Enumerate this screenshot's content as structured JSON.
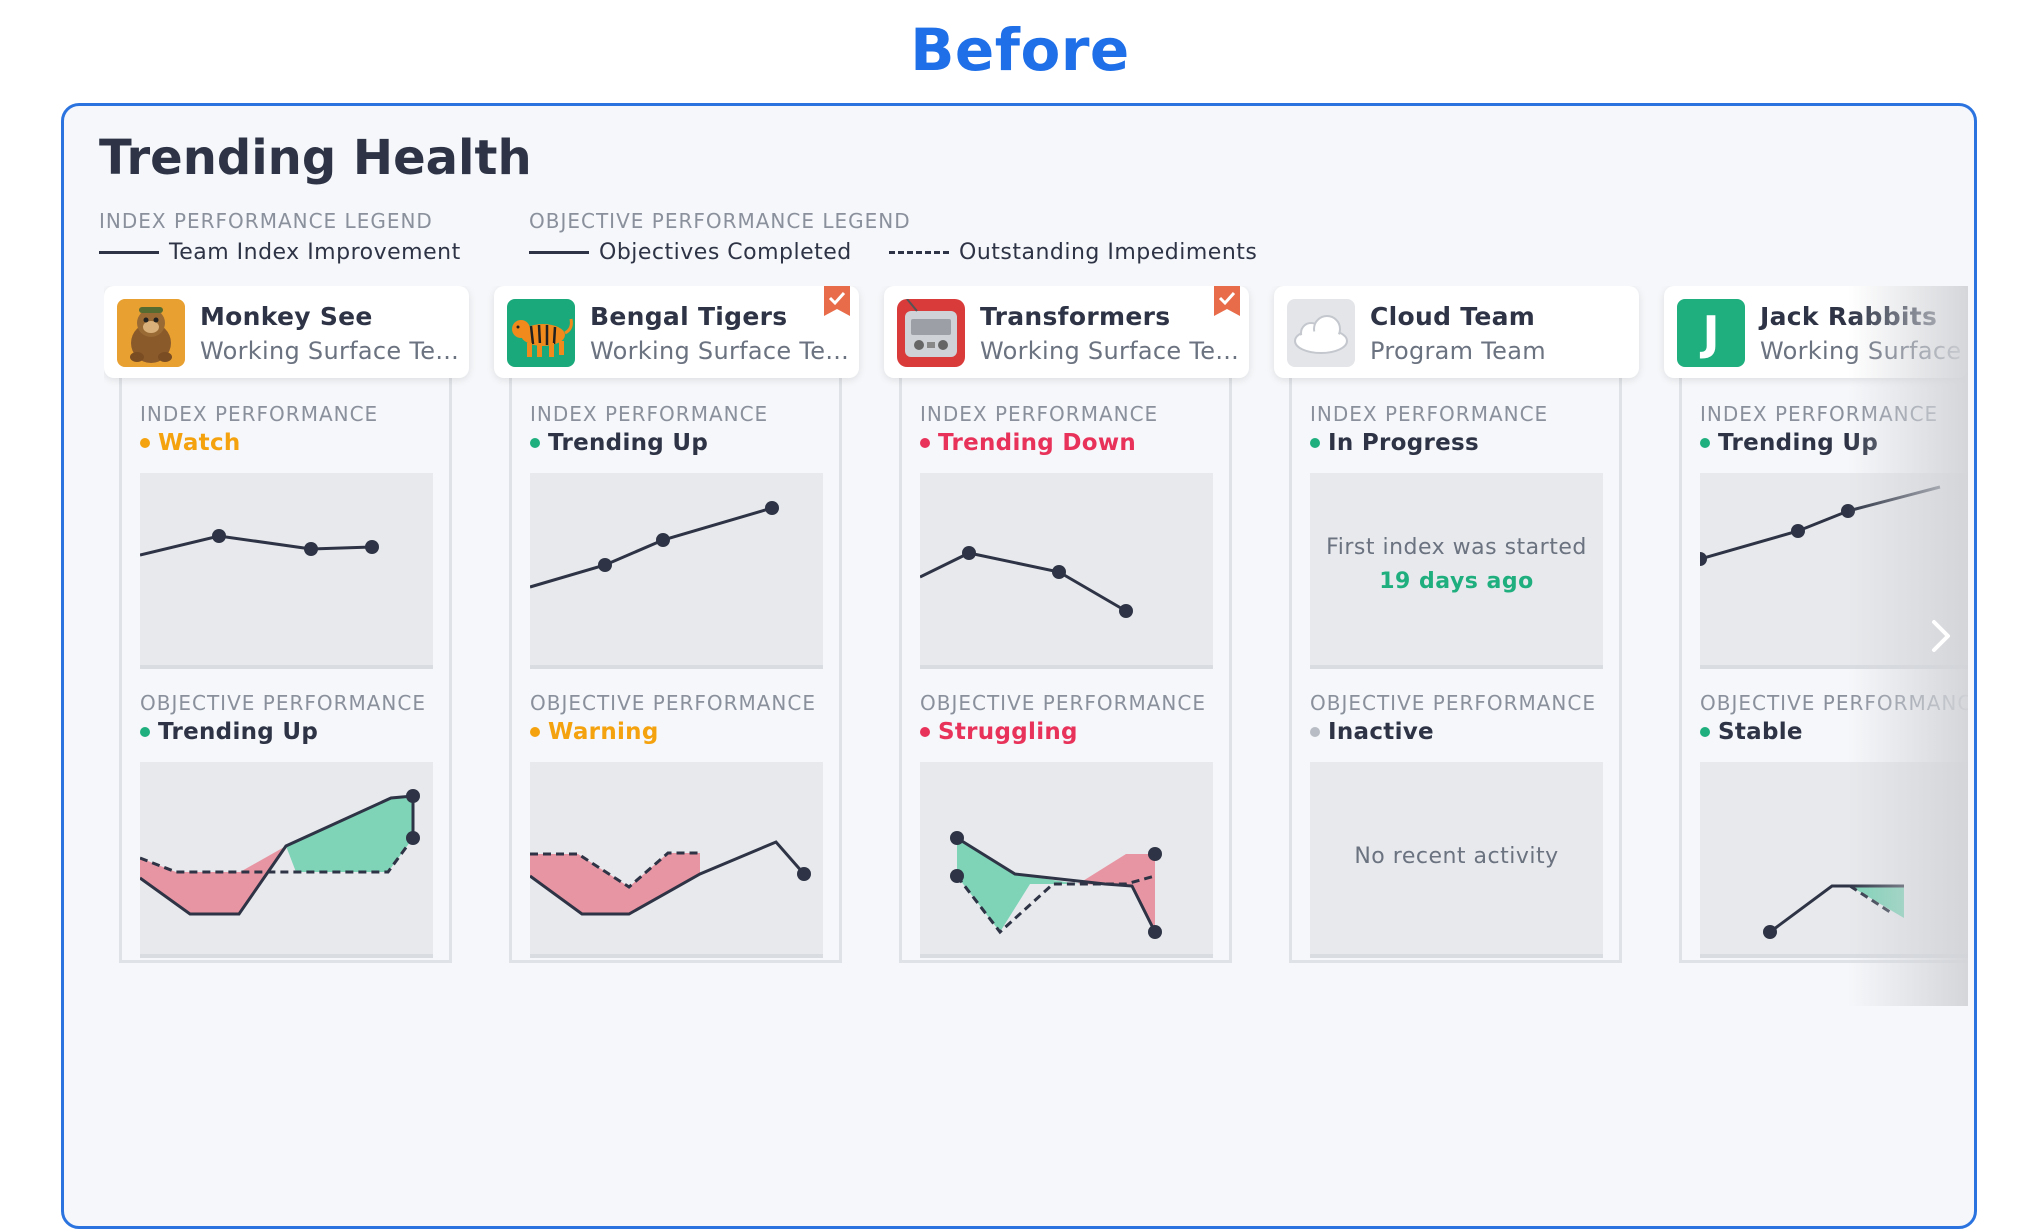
{
  "heading": "Before",
  "title": "Trending Health",
  "legend": {
    "index_header": "INDEX PERFORMANCE LEGEND",
    "index_item": "Team Index Improvement",
    "objective_header": "OBJECTIVE PERFORMANCE LEGEND",
    "objective_completed": "Objectives Completed",
    "outstanding_impediments": "Outstanding Impediments"
  },
  "colors": {
    "green": "#1fae7e",
    "orange": "#f5a20f",
    "red": "#e8325a",
    "gray": "#b8bcc4",
    "line": "#2e3445",
    "fill_green": "#7fd3b7",
    "fill_red": "#e895a3",
    "accent_blue": "#1e6fe8",
    "check_badge": "#e86c49"
  },
  "teams": [
    {
      "name": "Monkey See",
      "type": "Working Surface Te...",
      "avatar_icon": "monkey-toy-icon",
      "checked": false,
      "index": {
        "label": "INDEX PERFORMANCE",
        "status": "Watch",
        "status_color": "orange"
      },
      "objective": {
        "label": "OBJECTIVE PERFORMANCE",
        "status": "Trending Up",
        "status_color": "green"
      }
    },
    {
      "name": "Bengal Tigers",
      "type": "Working Surface Te...",
      "avatar_icon": "tiger-icon",
      "checked": true,
      "index": {
        "label": "INDEX PERFORMANCE",
        "status": "Trending Up",
        "status_color": "green"
      },
      "objective": {
        "label": "OBJECTIVE PERFORMANCE",
        "status": "Warning",
        "status_color": "orange"
      }
    },
    {
      "name": "Transformers",
      "type": "Working Surface Te...",
      "avatar_icon": "radio-icon",
      "checked": true,
      "index": {
        "label": "INDEX PERFORMANCE",
        "status": "Trending Down",
        "status_color": "red"
      },
      "objective": {
        "label": "OBJECTIVE PERFORMANCE",
        "status": "Struggling",
        "status_color": "red"
      }
    },
    {
      "name": "Cloud Team",
      "type": "Program Team",
      "avatar_icon": "cloud-icon",
      "checked": false,
      "index": {
        "label": "INDEX PERFORMANCE",
        "status": "In Progress",
        "status_color": "green",
        "message": "First index was started",
        "message_accent": "19 days ago"
      },
      "objective": {
        "label": "OBJECTIVE PERFORMANCE",
        "status": "Inactive",
        "status_color": "gray",
        "message": "No recent activity"
      }
    },
    {
      "name": "Jack Rabbits",
      "type": "Working Surface Team",
      "avatar_letter": "J",
      "avatar_color": "#1fae7e",
      "checked": false,
      "index": {
        "label": "INDEX PERFORMANCE",
        "status": "Trending Up",
        "status_color": "green"
      },
      "objective": {
        "label": "OBJECTIVE PERFORMANCE",
        "status": "Stable",
        "status_color": "green"
      }
    }
  ],
  "scroll_icon": "chevron-right-icon"
}
